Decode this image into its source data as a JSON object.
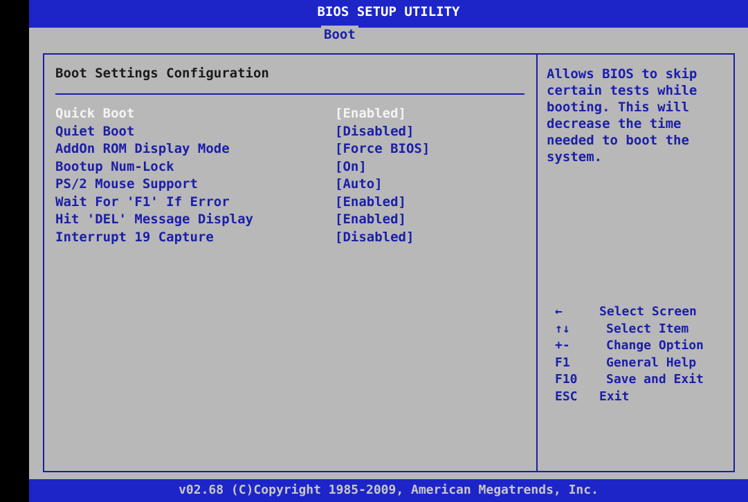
{
  "header": {
    "title": "BIOS SETUP UTILITY",
    "active_tab": "Boot"
  },
  "main": {
    "section_title": "Boot Settings Configuration",
    "settings": [
      {
        "label": "Quick Boot",
        "value": "[Enabled]",
        "selected": true
      },
      {
        "label": "Quiet Boot",
        "value": "[Disabled]",
        "selected": false
      },
      {
        "label": "AddOn ROM Display Mode",
        "value": "[Force BIOS]",
        "selected": false
      },
      {
        "label": "Bootup Num-Lock",
        "value": "[On]",
        "selected": false
      },
      {
        "label": "PS/2 Mouse Support",
        "value": "[Auto]",
        "selected": false
      },
      {
        "label": "Wait For 'F1' If Error",
        "value": "[Enabled]",
        "selected": false
      },
      {
        "label": "Hit 'DEL' Message Display",
        "value": "[Enabled]",
        "selected": false
      },
      {
        "label": "Interrupt 19 Capture",
        "value": "[Disabled]",
        "selected": false
      }
    ]
  },
  "help": {
    "text": "Allows BIOS to skip\ncertain tests while\nbooting. This will\ndecrease the time\nneeded to boot the\nsystem."
  },
  "keys": [
    {
      "key": "←",
      "desc": "Select Screen"
    },
    {
      "key": "↑↓",
      "desc": "Select Item"
    },
    {
      "key": "+-",
      "desc": "Change Option"
    },
    {
      "key": "F1",
      "desc": "General Help"
    },
    {
      "key": "F10",
      "desc": "Save and Exit"
    },
    {
      "key": "ESC",
      "desc": "Exit"
    }
  ],
  "footer": {
    "text": "v02.68 (C)Copyright 1985-2009, American Megatrends, Inc."
  },
  "colors": {
    "bar_blue": "#1d25c9",
    "text_blue": "#1a1ea8",
    "panel_gray": "#b8b8b8",
    "highlight": "#f4f4f4"
  }
}
